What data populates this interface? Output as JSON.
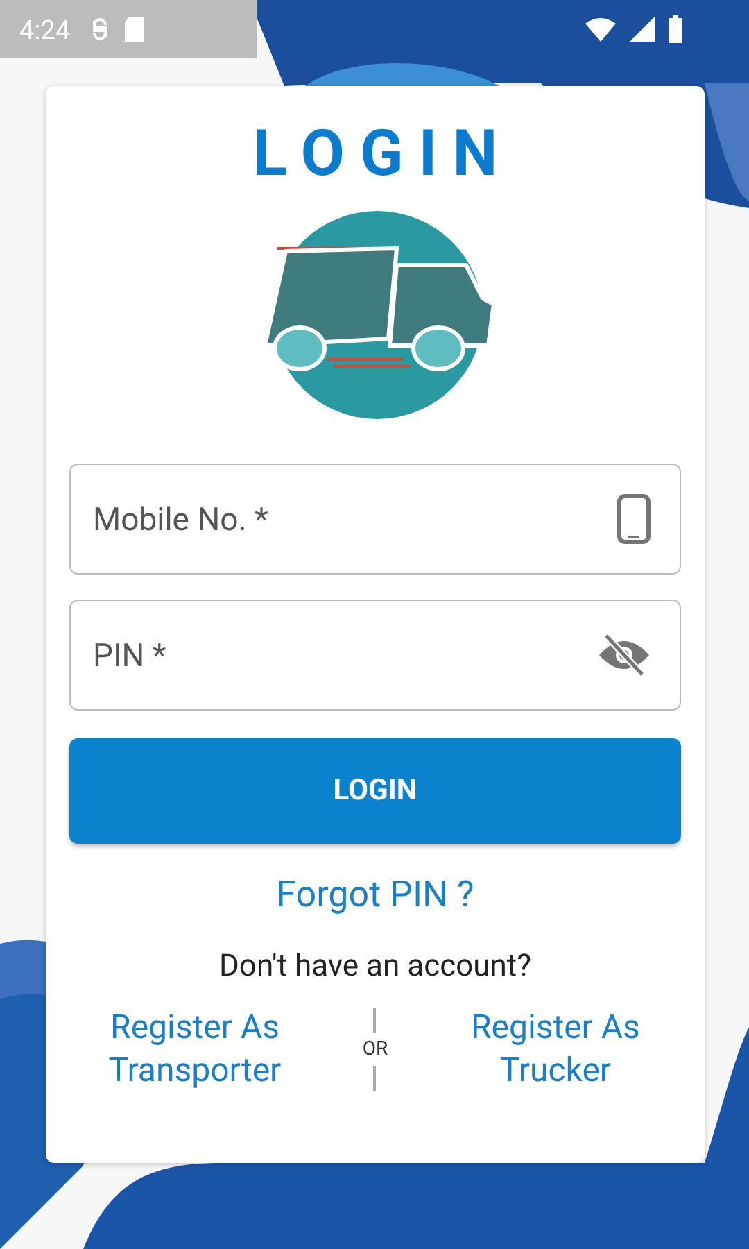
{
  "status_bar": {
    "time": "4:24"
  },
  "title": "LOGIN",
  "fields": [
    {
      "placeholder": "Mobile No. *",
      "kind": "phone"
    },
    {
      "placeholder": "PIN *",
      "kind": "pin"
    }
  ],
  "login_button": "LOGIN",
  "forgot_link": "Forgot PIN ?",
  "account_prompt": "Don't have an account?",
  "register_links": [
    "Register As Transporter",
    "Register As Trucker"
  ],
  "separator": "OR"
}
